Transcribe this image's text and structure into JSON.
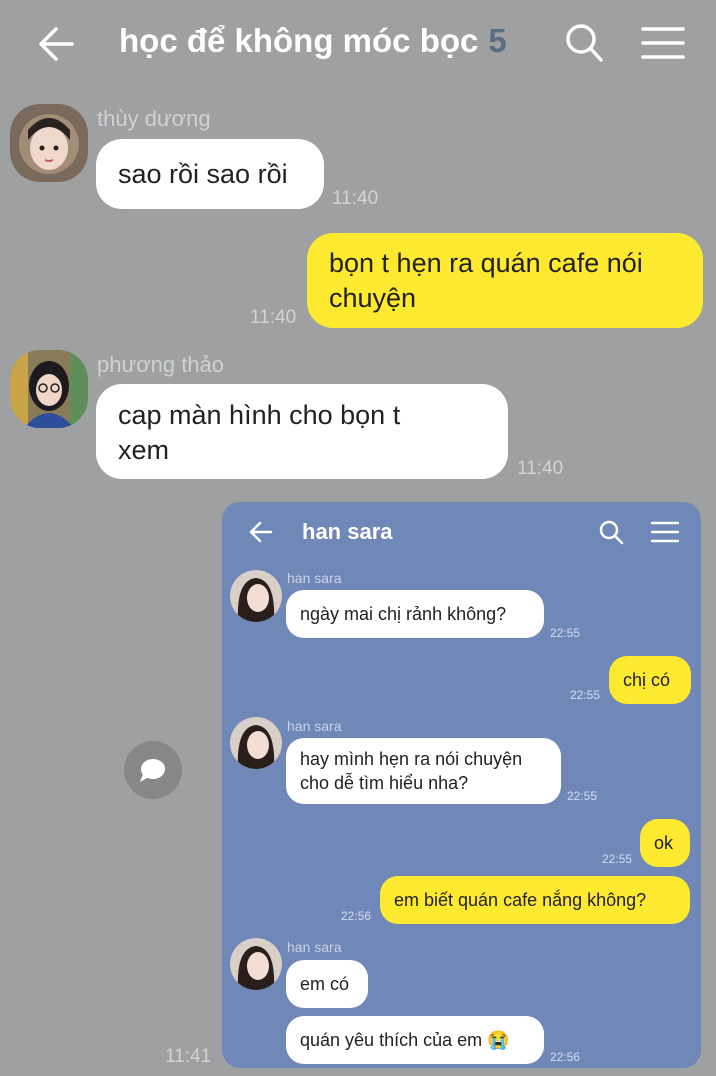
{
  "header": {
    "title": "học để không móc bọc",
    "member_count": "5",
    "back_icon": "arrow-left-icon",
    "search_icon": "search-icon",
    "menu_icon": "hamburger-menu-icon"
  },
  "messages": [
    {
      "sender": "thùy dương",
      "text_lines": [
        "sao rồi sao rồi"
      ],
      "time": "11:40"
    },
    {
      "text_lines": [
        "bọn t hẹn ra quán cafe nói",
        "chuyện"
      ],
      "time": "11:40"
    },
    {
      "sender": "phương thảo",
      "text_lines": [
        "cap màn hình cho bọn t",
        "xem"
      ],
      "time": "11:40"
    },
    {
      "time": "11:41"
    }
  ],
  "screenshot": {
    "title": "han sara",
    "messages": [
      {
        "sender": "han sara",
        "text": "ngày mai chị rảnh không?",
        "time": "22:55"
      },
      {
        "text": "chị có",
        "time": "22:55"
      },
      {
        "sender": "han sara",
        "text_lines": [
          "hay mình hẹn ra nói chuyện",
          "cho dễ tìm hiểu nha?"
        ],
        "time": "22:55"
      },
      {
        "text": "ok",
        "time": "22:55"
      },
      {
        "text": "em biết quán cafe nắng không?",
        "time": "22:56"
      },
      {
        "sender": "han sara",
        "text": "em có"
      },
      {
        "text": "quán yêu thích của em",
        "emoji": "😭",
        "time": "22:56"
      }
    ]
  },
  "colors": {
    "background": "#9ea0a2",
    "own_bubble": "#fde92f",
    "other_bubble": "#ffffff",
    "screenshot_background": "#6f88b8"
  }
}
